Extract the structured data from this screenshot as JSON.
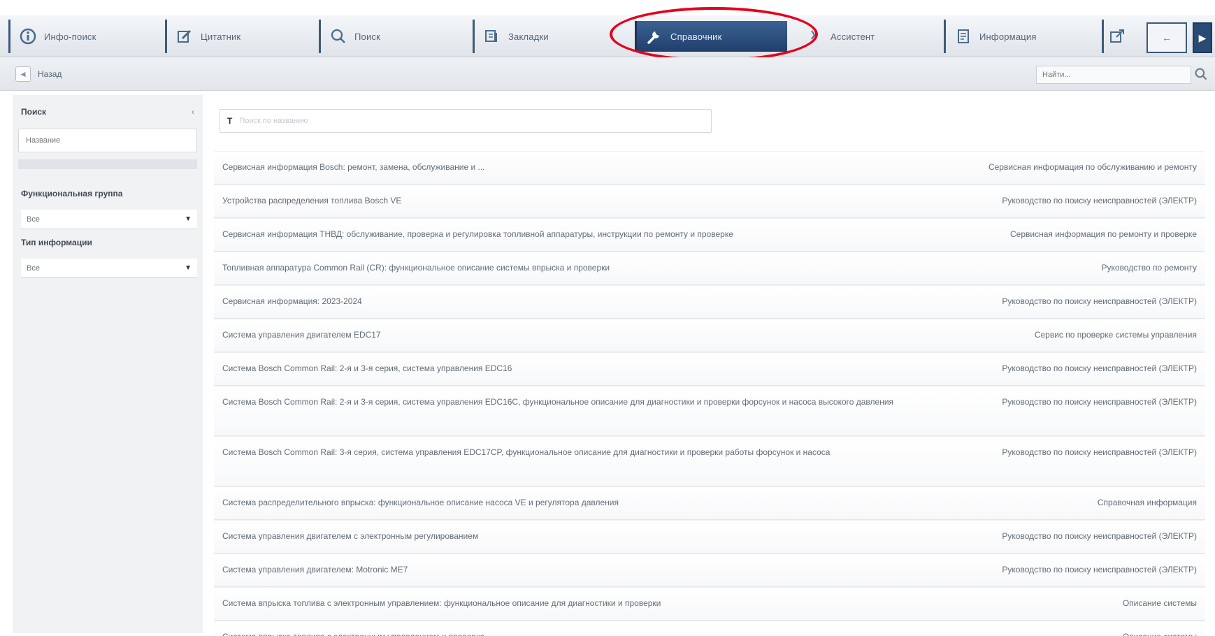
{
  "toolbar": {
    "items": [
      {
        "label": "Инфо-поиск",
        "icon": "info-icon"
      },
      {
        "label": "Цитатник",
        "icon": "bookmark-icon"
      },
      {
        "label": "Поиск",
        "icon": "search-icon"
      },
      {
        "label": "Закладки",
        "icon": "folder-icon"
      },
      {
        "label": "Справочник",
        "icon": "wrench-icon"
      },
      {
        "label": "Ассистент",
        "icon": "assistant-icon"
      },
      {
        "label": "Информация",
        "icon": "document-icon"
      }
    ],
    "active_index": 4,
    "nav_prev": "←",
    "nav_next": "▶"
  },
  "subbar": {
    "back_label": "Назад",
    "search_placeholder": "Найти..."
  },
  "sidebar": {
    "title": "Поиск",
    "collapse": "‹",
    "filter_placeholder": "Название",
    "group_label": "Функциональная группа",
    "group_value": "Все",
    "type_label": "Тип информации",
    "type_value": "Все"
  },
  "main": {
    "filter_prefix": "Т",
    "filter_placeholder": "Поиск по названию",
    "rows": [
      {
        "title": "Сервисная информация Bosch: ремонт, замена, обслуживание и ...",
        "category": "Сервисная информация по обслуживанию и ремонту"
      },
      {
        "title": "Устройства распределения топлива Bosch VE",
        "category": "Руководство по поиску неисправностей (ЭЛЕКТР)"
      },
      {
        "title": "Сервисная информация ТНВД: обслуживание, проверка и регулировка топливной аппаратуры, инструкции по ремонту и проверке",
        "category": "Сервисная информация по ремонту и проверке"
      },
      {
        "title": "Топливная аппаратура Common Rail (CR): функциональное описание системы впрыска и проверки",
        "category": "Руководство по ремонту"
      },
      {
        "title": "Сервисная информация: 2023-2024",
        "category": "Руководство по поиску неисправностей (ЭЛЕКТР)"
      },
      {
        "title": "Система управления двигателем EDC17",
        "category": "Сервис по проверке системы управления"
      },
      {
        "title": "Система Bosch Common Rail: 2-я и 3-я серия, система управления EDC16",
        "category": "Руководство по поиску неисправностей (ЭЛЕКТР)"
      },
      {
        "title": "Система Bosch Common Rail: 2-я и 3-я серия, система управления EDC16C, функциональное описание для диагностики и проверки форсунок и насоса высокого давления",
        "category": "Руководство по поиску неисправностей (ЭЛЕКТР)"
      },
      {
        "title": "Система Bosch Common Rail: 3-я серия, система управления EDC17CP, функциональное описание для диагностики и проверки работы форсунок и насоса",
        "category": "Руководство по поиску неисправностей (ЭЛЕКТР)"
      },
      {
        "title": "Система распределительного впрыска: функциональное описание насоса VE и регулятора давления",
        "category": "Справочная информация"
      },
      {
        "title": "Система управления двигателем с электронным регулированием",
        "category": "Руководство по поиску неисправностей (ЭЛЕКТР)"
      },
      {
        "title": "Система управления двигателем: Motronic ME7",
        "category": "Руководство по поиску неисправностей (ЭЛЕКТР)"
      },
      {
        "title": "Система впрыска топлива с электронным управлением: функциональное описание для диагностики и проверки",
        "category": "Описание системы"
      },
      {
        "title": "Система впрыска топлива с электронным управлением и проверка",
        "category": "Описание системы"
      }
    ]
  }
}
